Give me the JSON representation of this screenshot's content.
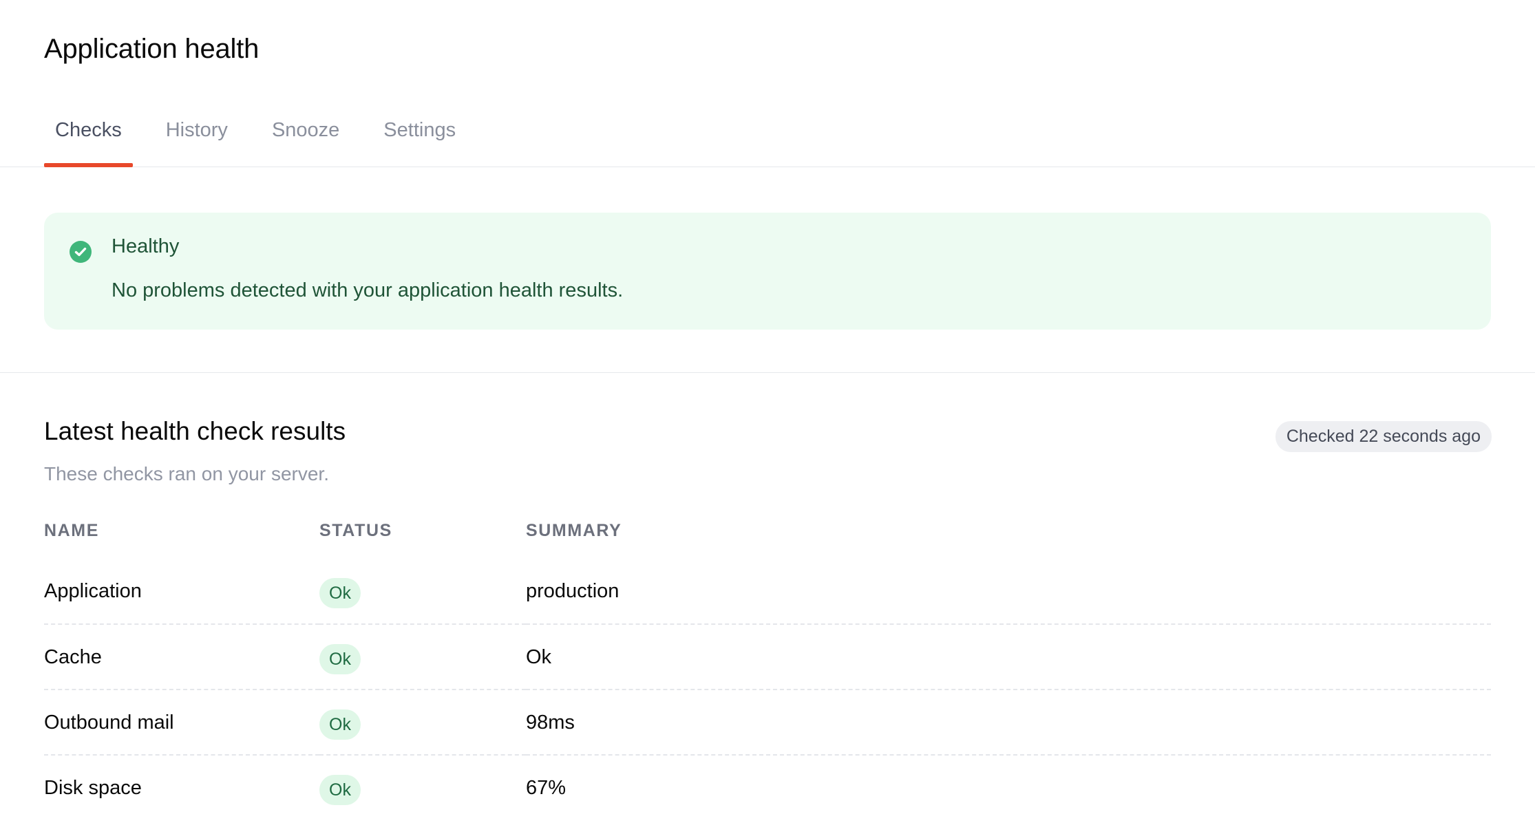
{
  "header": {
    "title": "Application health"
  },
  "tabs": [
    {
      "label": "Checks",
      "active": true
    },
    {
      "label": "History",
      "active": false
    },
    {
      "label": "Snooze",
      "active": false
    },
    {
      "label": "Settings",
      "active": false
    }
  ],
  "alert": {
    "icon": "check-circle-icon",
    "title": "Healthy",
    "message": "No problems detected with your application health results.",
    "color": "#3fb67a"
  },
  "results": {
    "title": "Latest health check results",
    "subtitle": "These checks ran on your server.",
    "checked_label": "Checked 22 seconds ago",
    "columns": [
      "NAME",
      "STATUS",
      "SUMMARY"
    ],
    "rows": [
      {
        "name": "Application",
        "status": "Ok",
        "summary": "production"
      },
      {
        "name": "Cache",
        "status": "Ok",
        "summary": "Ok"
      },
      {
        "name": "Outbound mail",
        "status": "Ok",
        "summary": "98ms"
      },
      {
        "name": "Disk space",
        "status": "Ok",
        "summary": "67%"
      }
    ]
  },
  "colors": {
    "accent": "#e8482a",
    "success_bg": "#edfbf2",
    "success_text": "#1f5437"
  }
}
